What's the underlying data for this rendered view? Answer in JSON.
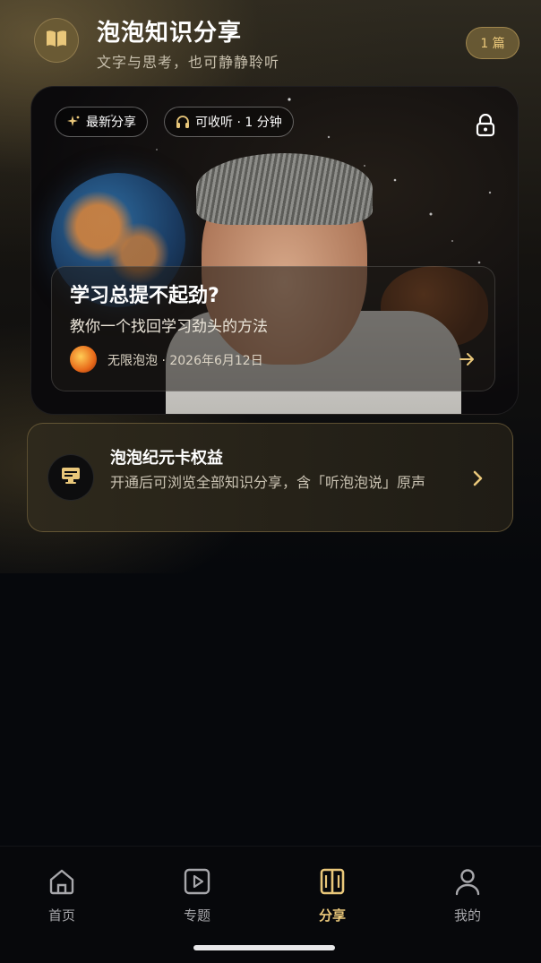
{
  "header": {
    "title": "泡泡知识分享",
    "subtitle": "文字与思考，也可静静聆听",
    "count_badge": "1 篇",
    "logo_icon": "open-book-icon"
  },
  "feature": {
    "chip_latest": "最新分享",
    "chip_latest_icon": "sparkle-icon",
    "chip_listen": "可收听 · 1 分钟",
    "chip_listen_icon": "headphones-icon",
    "lock_icon": "lock-icon",
    "article_title": "学习总提不起劲?",
    "article_subtitle": "教你一个找回学习劲头的方法",
    "author_meta": "无限泡泡 · 2026年6月12日",
    "arrow_icon": "arrow-right-icon"
  },
  "membership": {
    "title": "泡泡纪元卡权益",
    "description": "开通后可浏览全部知识分享，含「听泡泡说」原声",
    "icon": "card-icon",
    "chevron_icon": "chevron-right-icon"
  },
  "nav": {
    "items": [
      {
        "label": "首页",
        "icon": "home-icon",
        "active": false
      },
      {
        "label": "专题",
        "icon": "play-square-icon",
        "active": false
      },
      {
        "label": "分享",
        "icon": "columns-book-icon",
        "active": true
      },
      {
        "label": "我的",
        "icon": "user-icon",
        "active": false
      }
    ]
  },
  "colors": {
    "accent_gold": "#e9c77a",
    "background": "#06080c",
    "card_border": "#c8aa64"
  }
}
